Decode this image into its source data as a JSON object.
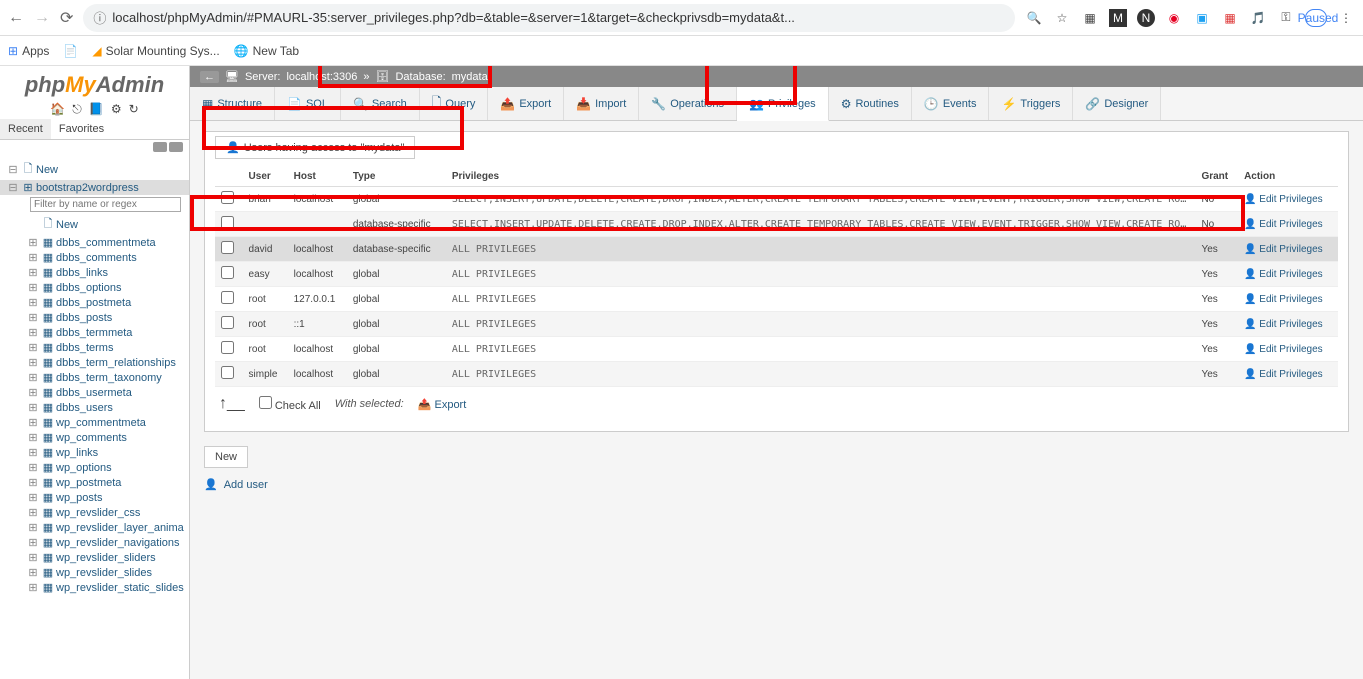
{
  "browser": {
    "url": "localhost/phpMyAdmin/#PMAURL-35:server_privileges.php?db=&table=&server=1&target=&checkprivsdb=mydata&t...",
    "paused": "Paused"
  },
  "bookmarks": {
    "apps": "Apps",
    "solar": "Solar Mounting Sys...",
    "newtab": "New Tab"
  },
  "logo": {
    "php": "php",
    "my": "My",
    "admin": "Admin"
  },
  "sidetabs": {
    "recent": "Recent",
    "favorites": "Favorites"
  },
  "tree": {
    "new": "New",
    "db": "bootstrap2wordpress",
    "filter_placeholder": "Filter by name or regex",
    "subnew": "New",
    "tables": [
      "dbbs_commentmeta",
      "dbbs_comments",
      "dbbs_links",
      "dbbs_options",
      "dbbs_postmeta",
      "dbbs_posts",
      "dbbs_termmeta",
      "dbbs_terms",
      "dbbs_term_relationships",
      "dbbs_term_taxonomy",
      "dbbs_usermeta",
      "dbbs_users",
      "wp_commentmeta",
      "wp_comments",
      "wp_links",
      "wp_options",
      "wp_postmeta",
      "wp_posts",
      "wp_revslider_css",
      "wp_revslider_layer_anima",
      "wp_revslider_navigations",
      "wp_revslider_sliders",
      "wp_revslider_slides",
      "wp_revslider_static_slides"
    ]
  },
  "breadcrumb": {
    "server_label": "Server:",
    "server_value": "localhost:3306",
    "db_label": "Database:",
    "db_value": "mydata"
  },
  "tabs": [
    {
      "label": "Structure"
    },
    {
      "label": "SQL"
    },
    {
      "label": "Search"
    },
    {
      "label": "Query"
    },
    {
      "label": "Export"
    },
    {
      "label": "Import"
    },
    {
      "label": "Operations"
    },
    {
      "label": "Privileges"
    },
    {
      "label": "Routines"
    },
    {
      "label": "Events"
    },
    {
      "label": "Triggers"
    },
    {
      "label": "Designer"
    }
  ],
  "legend": "Users having access to \"mydata\"",
  "columns": {
    "user": "User",
    "host": "Host",
    "type": "Type",
    "privs": "Privileges",
    "grant": "Grant",
    "action": "Action"
  },
  "rows": [
    {
      "user": "brian",
      "host": "localhost",
      "type": "global",
      "privs": "SELECT,INSERT,UPDATE,DELETE,CREATE,DROP,INDEX,ALTER,CREATE TEMPORARY TABLES,CREATE VIEW,EVENT,TRIGGER,SHOW VIEW,CREATE ROUTINE,ALTER ROUTINE,EXECUTE",
      "grant": "No",
      "action": "Edit Privileges"
    },
    {
      "user": "",
      "host": "",
      "type": "database-specific",
      "privs": "SELECT,INSERT,UPDATE,DELETE,CREATE,DROP,INDEX,ALTER,CREATE TEMPORARY TABLES,CREATE VIEW,EVENT,TRIGGER,SHOW VIEW,CREATE ROUTINE,ALTER ROUTINE,EXECUTE",
      "grant": "No",
      "action": "Edit Privileges"
    },
    {
      "user": "david",
      "host": "localhost",
      "type": "database-specific",
      "privs": "ALL PRIVILEGES",
      "grant": "Yes",
      "action": "Edit Privileges"
    },
    {
      "user": "easy",
      "host": "localhost",
      "type": "global",
      "privs": "ALL PRIVILEGES",
      "grant": "Yes",
      "action": "Edit Privileges"
    },
    {
      "user": "root",
      "host": "127.0.0.1",
      "type": "global",
      "privs": "ALL PRIVILEGES",
      "grant": "Yes",
      "action": "Edit Privileges"
    },
    {
      "user": "root",
      "host": "::1",
      "type": "global",
      "privs": "ALL PRIVILEGES",
      "grant": "Yes",
      "action": "Edit Privileges"
    },
    {
      "user": "root",
      "host": "localhost",
      "type": "global",
      "privs": "ALL PRIVILEGES",
      "grant": "Yes",
      "action": "Edit Privileges"
    },
    {
      "user": "simple",
      "host": "localhost",
      "type": "global",
      "privs": "ALL PRIVILEGES",
      "grant": "Yes",
      "action": "Edit Privileges"
    }
  ],
  "footer": {
    "checkall": "Check All",
    "withsel": "With selected:",
    "export": "Export"
  },
  "newbox": "New",
  "adduser": "Add user"
}
